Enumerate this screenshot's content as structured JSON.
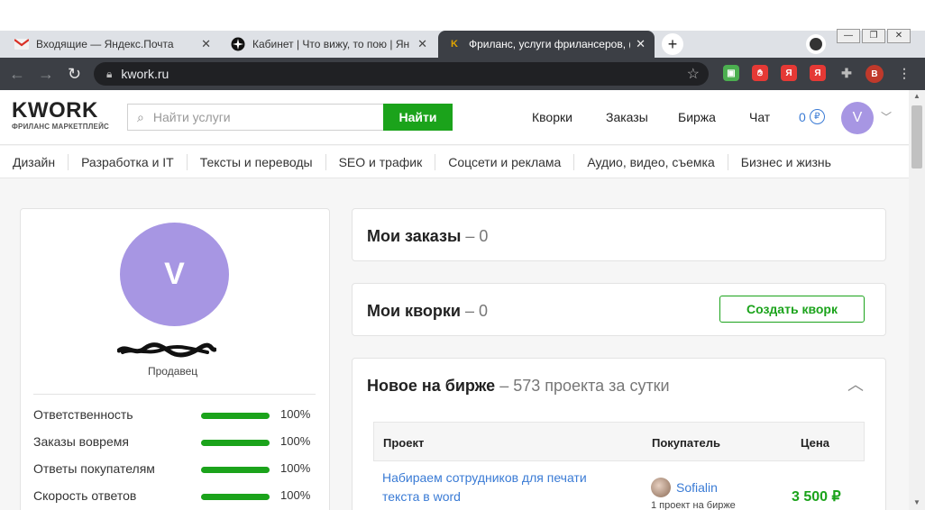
{
  "browser": {
    "tabs": [
      {
        "title": "Входящие — Яндекс.Почта",
        "favicon": "gmail-envelope-icon"
      },
      {
        "title": "Кабинет | Что вижу, то пою | Ян",
        "favicon": "compass-icon"
      },
      {
        "title": "Фриланс, услуги фрилансеров, (",
        "favicon": "kwork-k-icon"
      }
    ],
    "new_tab": "+",
    "address": "kwork.ru",
    "extensions": [
      "video-icon",
      "hand-icon",
      "yandex-icon",
      "yandex-icon",
      "puzzle-icon"
    ],
    "profile_letter": "В"
  },
  "header": {
    "logo_main": "KWORK",
    "logo_sub": "ФРИЛАНС МАРКЕТПЛЕЙС",
    "search_placeholder": "Найти услуги",
    "search_button": "Найти",
    "nav": [
      "Кворки",
      "Заказы",
      "Биржа",
      "Чат"
    ],
    "balance": "0",
    "currency_symbol": "₽",
    "user_initial": "V"
  },
  "categories": [
    "Дизайн",
    "Разработка и IT",
    "Тексты и переводы",
    "SEO и трафик",
    "Соцсети и реклама",
    "Аудио, видео, съемка",
    "Бизнес и жизнь"
  ],
  "profile": {
    "initial": "V",
    "role": "Продавец",
    "stats": [
      {
        "label": "Ответственность",
        "value": "100%",
        "level": 1.0
      },
      {
        "label": "Заказы вовремя",
        "value": "100%",
        "level": 1.0
      },
      {
        "label": "Ответы покупателям",
        "value": "100%",
        "level": 1.0
      },
      {
        "label": "Скорость ответов",
        "value": "100%",
        "level": 1.0
      }
    ]
  },
  "orders": {
    "title": "Мои заказы",
    "count": "– 0"
  },
  "kworks": {
    "title": "Мои кворки",
    "count": "– 0",
    "create_button": "Создать кворк"
  },
  "exchange": {
    "title": "Новое на бирже",
    "count": "– 573 проекта за сутки",
    "columns": [
      "Проект",
      "Покупатель",
      "Цена"
    ],
    "rows": [
      {
        "project": "Набираем сотрудников для печати текста в word",
        "buyer": "Sofialin",
        "buyer_sub": "1 проект на бирже",
        "price": "3 500 ₽"
      }
    ]
  },
  "colors": {
    "accent_green": "#1ba31b",
    "avatar_purple": "#a796e3",
    "link_blue": "#3a7bd5"
  }
}
